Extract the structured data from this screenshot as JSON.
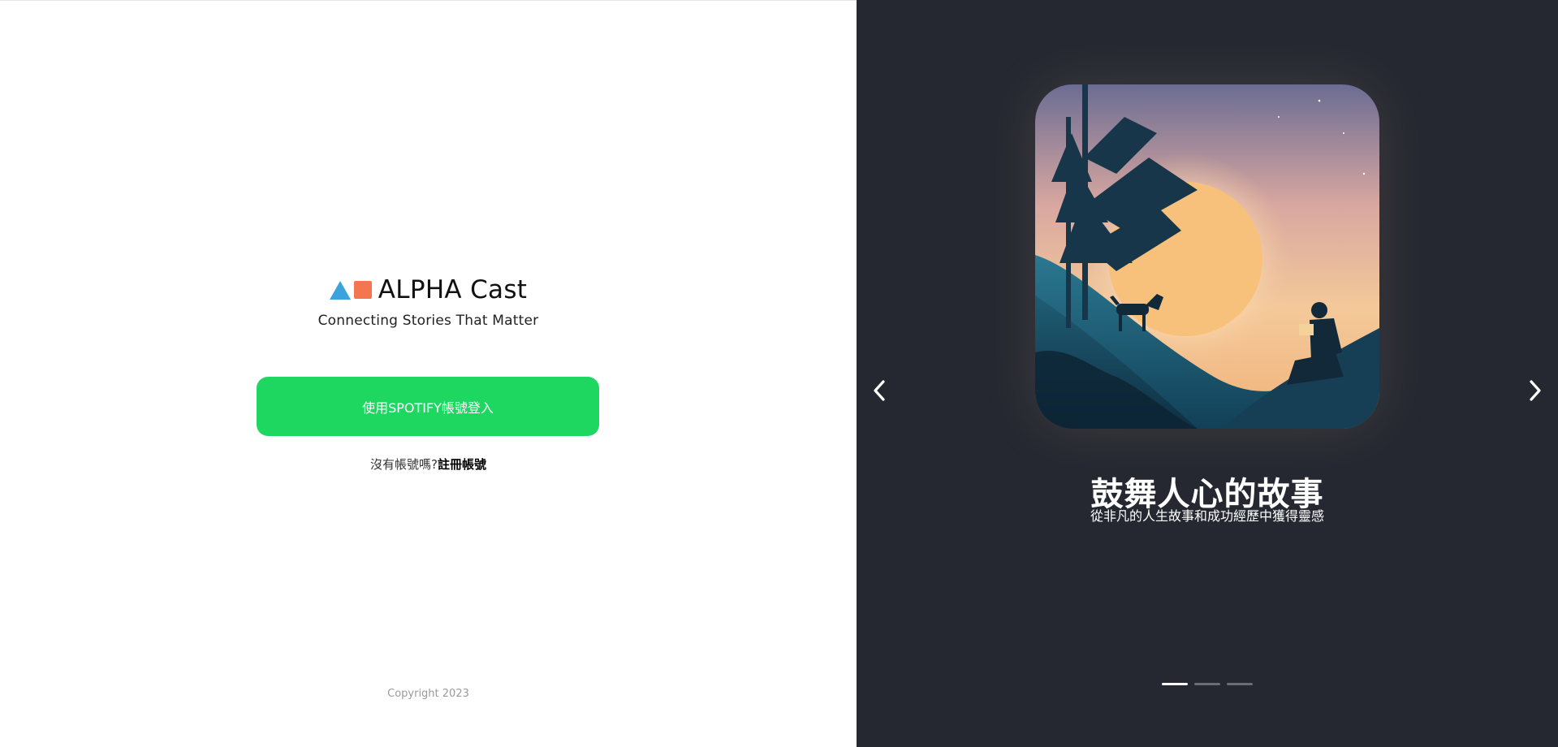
{
  "brand": {
    "name": "ALPHA Cast",
    "tagline": "Connecting Stories That Matter",
    "logo_colors": {
      "triangle": "#3aa3dc",
      "square": "#f5764e"
    }
  },
  "login": {
    "spotify_button_label": "使用SPOTIFY帳號登入",
    "spotify_button_color": "#1ed760",
    "no_account_text": "沒有帳號嗎?",
    "signup_link": "註冊帳號"
  },
  "footer": {
    "copyright": "Copyright 2023"
  },
  "carousel": {
    "background_color": "#252831",
    "prev_icon": "chevron-left-icon",
    "next_icon": "chevron-right-icon",
    "slide": {
      "title": "鼓舞人心的故事",
      "subtitle": "從非凡的人生故事和成功經歷中獲得靈感",
      "image": "illustration-sunset-reader-dog"
    },
    "dots": {
      "count": 3,
      "active_index": 0
    }
  }
}
